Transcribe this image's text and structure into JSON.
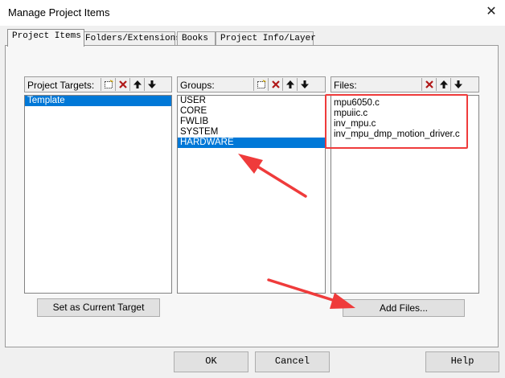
{
  "window": {
    "title": "Manage Project Items"
  },
  "tabs": [
    {
      "label": "Project Items"
    },
    {
      "label": "Folders/Extensions"
    },
    {
      "label": "Books"
    },
    {
      "label": "Project Info/Layer"
    }
  ],
  "targets": {
    "label": "Project Targets:",
    "items": [
      "Template"
    ],
    "selected_index": 0,
    "set_current_label": "Set as Current Target"
  },
  "groups": {
    "label": "Groups:",
    "items": [
      "USER",
      "CORE",
      "FWLIB",
      "SYSTEM",
      "HARDWARE"
    ],
    "selected_index": 4
  },
  "files": {
    "label": "Files:",
    "items": [
      "mpu6050.c",
      "mpuiic.c",
      "inv_mpu.c",
      "inv_mpu_dmp_motion_driver.c"
    ],
    "add_files_label": "Add Files..."
  },
  "footer": {
    "ok_label": "OK",
    "cancel_label": "Cancel",
    "help_label": "Help"
  },
  "colors": {
    "selection": "#0078d7",
    "annotation": "#ef3b3b"
  },
  "icons": {
    "new_item": "new-item-icon",
    "delete": "delete-icon",
    "move_up": "arrow-up-icon",
    "move_down": "arrow-down-icon",
    "close": "close-icon"
  }
}
